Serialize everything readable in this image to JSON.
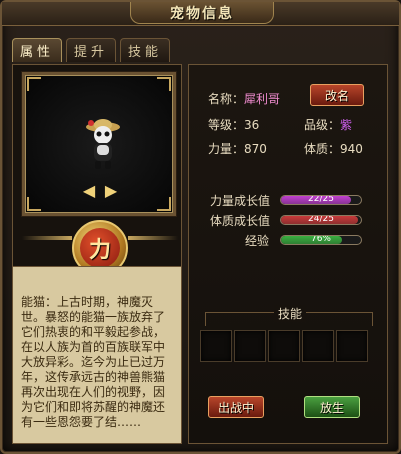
{
  "window": {
    "title": "宠物信息"
  },
  "tabs": [
    {
      "label": "属性"
    },
    {
      "label": "提升"
    },
    {
      "label": "技能"
    }
  ],
  "pet": {
    "name_label": "名称：",
    "name_value": "犀利哥",
    "rename_button": "改名",
    "level_label": "等级：",
    "level_value": "36",
    "quality_label": "品级：",
    "quality_value": "紫",
    "power_label": "力量：",
    "power_value": "870",
    "stamina_label": "体质：",
    "stamina_value": "940",
    "emblem_char": "力"
  },
  "growth": {
    "power_label": "力量成长值",
    "power_text": "22/25",
    "power_fraction": 0.88,
    "stamina_label": "体质成长值",
    "stamina_text": "24/25",
    "stamina_fraction": 0.96,
    "exp_label": "经验",
    "exp_text": "76%",
    "exp_fraction": 0.76
  },
  "colors": {
    "power_bar": "#c040d0",
    "stamina_bar": "#c83a3a",
    "exp_bar": "#3ab040"
  },
  "skills": {
    "label": "技能"
  },
  "description": "能猫：上古时期，神魔灭世。暴怒的能猫一族放弃了它们热衷的和平毅起参战，在以人族为首的百族联军中大放异彩。迄今为止已过万年，这传承远古的神兽熊猫再次出现在人们的视野，因为它们和即将苏醒的神魔还有一些恩怨要了结……",
  "buttons": {
    "battle": "出战中",
    "release": "放生"
  },
  "icons": {
    "left_arrow": "arrow-left-icon",
    "right_arrow": "arrow-right-icon"
  }
}
